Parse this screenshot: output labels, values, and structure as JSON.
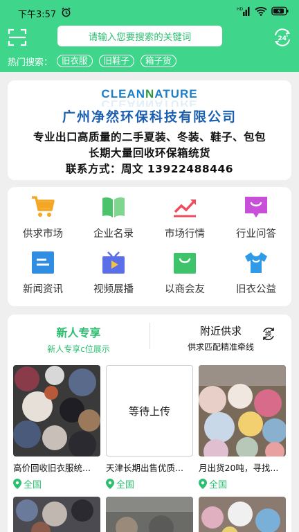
{
  "status_bar": {
    "time": "下午3:57"
  },
  "header": {
    "search_placeholder": "请输入您要搜索的关键词",
    "hot_label": "热门搜索：",
    "hot_tags": [
      "旧衣服",
      "旧鞋子",
      "箱子货"
    ]
  },
  "banner": {
    "logo_part1": "CLEAN",
    "logo_part2": "N",
    "logo_part3": "ATURE",
    "company": "广州净然环保科技有限公司",
    "line1": "专业出口高质量的二手夏装、冬装、鞋子、包包",
    "line2": "长期大量回收环保箱统货",
    "line3": "联系方式：周文 13922488446"
  },
  "categories": [
    {
      "label": "供求市场",
      "icon": "cart-icon",
      "color": "#f5a623"
    },
    {
      "label": "企业名录",
      "icon": "book-icon",
      "color": "#4cc36a"
    },
    {
      "label": "市场行情",
      "icon": "trend-chart-icon",
      "color": "#ef4b5f"
    },
    {
      "label": "行业问答",
      "icon": "chat-bubble-icon",
      "color": "#c84fd8"
    },
    {
      "label": "新闻资讯",
      "icon": "news-icon",
      "color": "#2f8de4"
    },
    {
      "label": "视频展播",
      "icon": "tv-icon",
      "color": "#5a6ee8"
    },
    {
      "label": "以商会友",
      "icon": "bag-icon",
      "color": "#3dc46a"
    },
    {
      "label": "旧衣公益",
      "icon": "tshirt-icon",
      "color": "#2f9be8"
    }
  ],
  "feed": {
    "tab_new_title": "新人专享",
    "tab_new_sub": "新人专享c位展示",
    "tab_nearby_title": "附近供求",
    "tab_nearby_sub": "供求匹配精准牵线",
    "swap_label": "换",
    "placeholder_text": "等待上传",
    "products": [
      {
        "title": "高价回收旧衣服统...",
        "location": "全国"
      },
      {
        "title": "天津长期出售优质...",
        "location": "全国"
      },
      {
        "title": "月出货20吨，寻找...",
        "location": "全国"
      }
    ]
  },
  "colors": {
    "brand_green": "#3fd68c",
    "accent_green": "#2bbf70"
  }
}
